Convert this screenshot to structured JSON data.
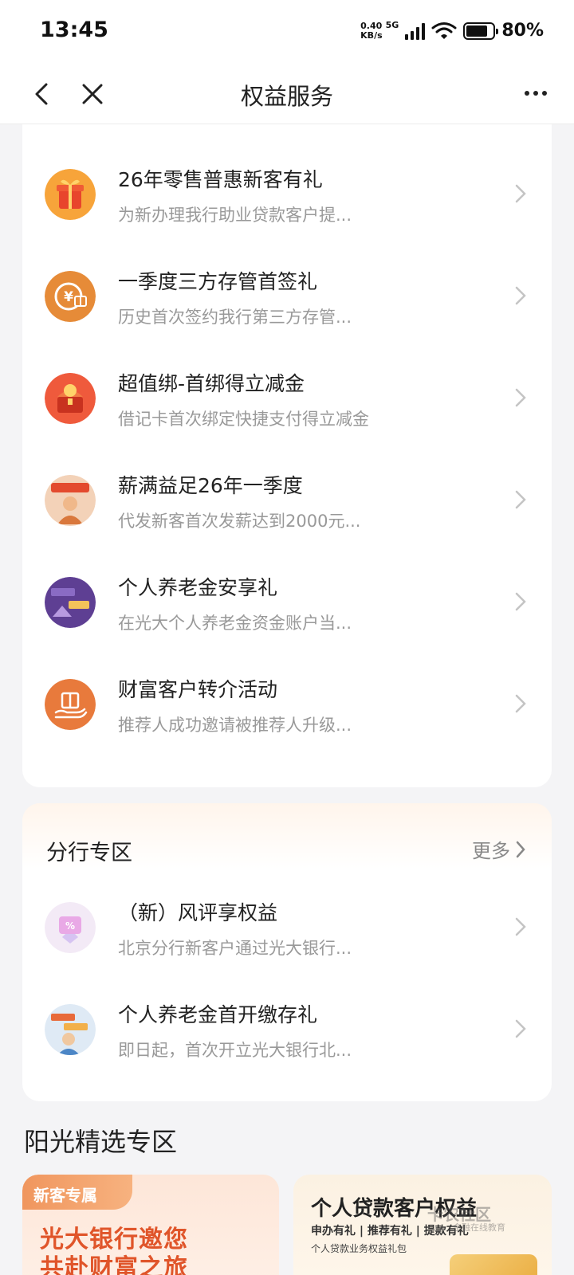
{
  "status_bar": {
    "time": "13:45",
    "net_speed_top": "0.40",
    "net_speed_bottom": "KB/s",
    "network": "5G",
    "battery": "80%"
  },
  "nav": {
    "title": "权益服务"
  },
  "benefits": [
    {
      "title": "26年零售普惠新客有礼",
      "subtitle": "为新办理我行助业贷款客户提...",
      "icon": "gift-box-icon",
      "color": "#f2742b"
    },
    {
      "title": "一季度三方存管首签礼",
      "subtitle": "历史首次签约我行第三方存管...",
      "icon": "yuan-gift-icon",
      "color": "#e88a3a"
    },
    {
      "title": "超值绑-首绑得立减金",
      "subtitle": "借记卡首次绑定快捷支付得立减金",
      "icon": "treasure-chest-icon",
      "color": "#e24a35"
    },
    {
      "title": "薪满益足26年一季度",
      "subtitle": "代发新客首次发薪达到2000元...",
      "icon": "salary-promo-icon",
      "color": "#d9783d"
    },
    {
      "title": "个人养老金安享礼",
      "subtitle": "在光大个人养老金资金账户当...",
      "icon": "pension-promo-icon",
      "color": "#5b3c8f"
    },
    {
      "title": "财富客户转介活动",
      "subtitle": "推荐人成功邀请被推荐人升级...",
      "icon": "hand-gift-icon",
      "color": "#e4743a"
    }
  ],
  "branch": {
    "title": "分行专区",
    "more": "更多",
    "items": [
      {
        "title": "（新）风评享权益",
        "subtitle": "北京分行新客户通过光大银行...",
        "icon": "coupon-diamond-icon",
        "color": "#e9b6e8"
      },
      {
        "title": "个人养老金首开缴存礼",
        "subtitle": "即日起，首次开立光大银行北...",
        "icon": "pension-open-icon",
        "color": "#7aa8d8"
      }
    ]
  },
  "sunshine": {
    "title": "阳光精选专区",
    "promo_left": {
      "tag": "新客专属",
      "line1": "光大银行邀您",
      "line2": "共赴财富之旅"
    },
    "promo_right": {
      "title": "个人贷款客户权益",
      "sub": "申办有礼 | 推荐有礼 | 提款有礼",
      "sub2": "个人贷款业务权益礼包",
      "watermark": "卡农社区",
      "watermark_sub": "金融在线教育"
    }
  }
}
